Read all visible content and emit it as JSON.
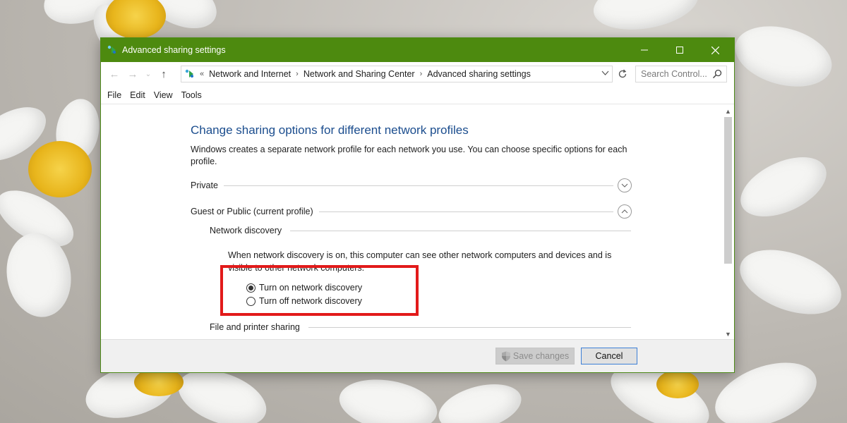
{
  "window": {
    "title": "Advanced sharing settings",
    "accent_color": "#4d8a0f",
    "title_icon": "network-sharing-icon",
    "controls": [
      "minimize-icon",
      "maximize-icon",
      "close-icon"
    ]
  },
  "navigation": {
    "back_icon": "arrow-left-icon",
    "forward_icon": "arrow-right-icon",
    "recent_icon": "chevron-down-icon",
    "up_icon": "arrow-up-icon",
    "breadcrumb_prefix": "«",
    "breadcrumbs": [
      "Network and Internet",
      "Network and Sharing Center",
      "Advanced sharing settings"
    ],
    "search_placeholder": "Search Control..."
  },
  "menu": {
    "items": [
      "File",
      "Edit",
      "View",
      "Tools"
    ]
  },
  "page": {
    "heading": "Change sharing options for different network profiles",
    "description": "Windows creates a separate network profile for each network you use. You can choose specific options for each profile.",
    "heading_color": "#1b4d8e",
    "profiles": [
      {
        "label": "Private",
        "expanded": false
      },
      {
        "label": "Guest or Public (current profile)",
        "expanded": true
      }
    ],
    "network_discovery": {
      "label": "Network discovery",
      "text": "When network discovery is on, this computer can see other network computers and devices and is visible to other network computers.",
      "options": [
        {
          "label": "Turn on network discovery",
          "selected": true
        },
        {
          "label": "Turn off network discovery",
          "selected": false
        }
      ],
      "highlight_color": "#e21a1a"
    },
    "file_printer_sharing": {
      "label": "File and printer sharing"
    }
  },
  "footer": {
    "save_label": "Save changes",
    "save_icon": "uac-shield-icon",
    "save_enabled": false,
    "cancel_label": "Cancel"
  }
}
